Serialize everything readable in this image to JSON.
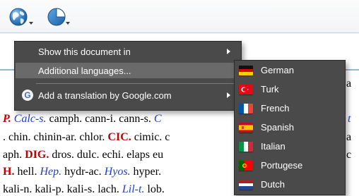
{
  "toolbar": {
    "icons": [
      "globe-icon",
      "pie-chart-icon"
    ]
  },
  "document": {
    "lines": [
      {
        "segments": [
          {
            "text": "P.",
            "style": "rb"
          },
          {
            "text": " ",
            "style": "n"
          },
          {
            "text": "Calc-s.",
            "style": "b"
          },
          {
            "text": " camph. cann-i. cann-s. ",
            "style": "n"
          },
          {
            "text": "C",
            "style": "b"
          }
        ]
      },
      {
        "segments": [
          {
            "text": ". chin. chinin-ar. chlor. ",
            "style": "n"
          },
          {
            "text": "CIC.",
            "style": "r"
          },
          {
            "text": " cimic. c",
            "style": "n"
          }
        ]
      },
      {
        "segments": [
          {
            "text": "aph. ",
            "style": "n"
          },
          {
            "text": "DIG.",
            "style": "r"
          },
          {
            "text": " dros. dulc. echi. elaps eu",
            "style": "n"
          }
        ]
      },
      {
        "segments": [
          {
            "text": "H.",
            "style": "r"
          },
          {
            "text": " hell. ",
            "style": "n"
          },
          {
            "text": "Hep.",
            "style": "b"
          },
          {
            "text": " hydr-ac. ",
            "style": "n"
          },
          {
            "text": "Hyos.",
            "style": "b"
          },
          {
            "text": " hyper.",
            "style": "n"
          }
        ]
      },
      {
        "segments": [
          {
            "text": "kali-n. kali-p. kali-s. lach. ",
            "style": "n"
          },
          {
            "text": "Lil-t.",
            "style": "b"
          },
          {
            "text": " lob.",
            "style": "n"
          }
        ]
      }
    ],
    "right_edge": {
      "line1": "a",
      "line2": "t",
      "line3": "a",
      "line4": "c",
      "line5": "e"
    }
  },
  "context_menu": {
    "items": [
      {
        "label": "Show this document in",
        "has_submenu": true
      },
      {
        "label": "Additional languages...",
        "has_submenu": false,
        "highlighted": true
      },
      {
        "label": "Add a translation by Google.com",
        "has_submenu": true,
        "icon": "google-icon"
      }
    ]
  },
  "language_submenu": {
    "items": [
      {
        "label": "German",
        "flag": "germany-flag-icon"
      },
      {
        "label": "Turk",
        "flag": "turkey-flag-icon"
      },
      {
        "label": "French",
        "flag": "france-flag-icon"
      },
      {
        "label": "Spanish",
        "flag": "spain-flag-icon"
      },
      {
        "label": "Italian",
        "flag": "italy-flag-icon"
      },
      {
        "label": "Portugese",
        "flag": "portugal-flag-icon"
      },
      {
        "label": "Dutch",
        "flag": "netherlands-flag-icon"
      }
    ]
  },
  "colors": {
    "menu_background": "#4a4a4a",
    "menu_highlight": "#6a6a6a",
    "keyword_red": "#c00000",
    "remedy_blue": "#1f3ecc",
    "divider_blue": "#94b6cf"
  }
}
